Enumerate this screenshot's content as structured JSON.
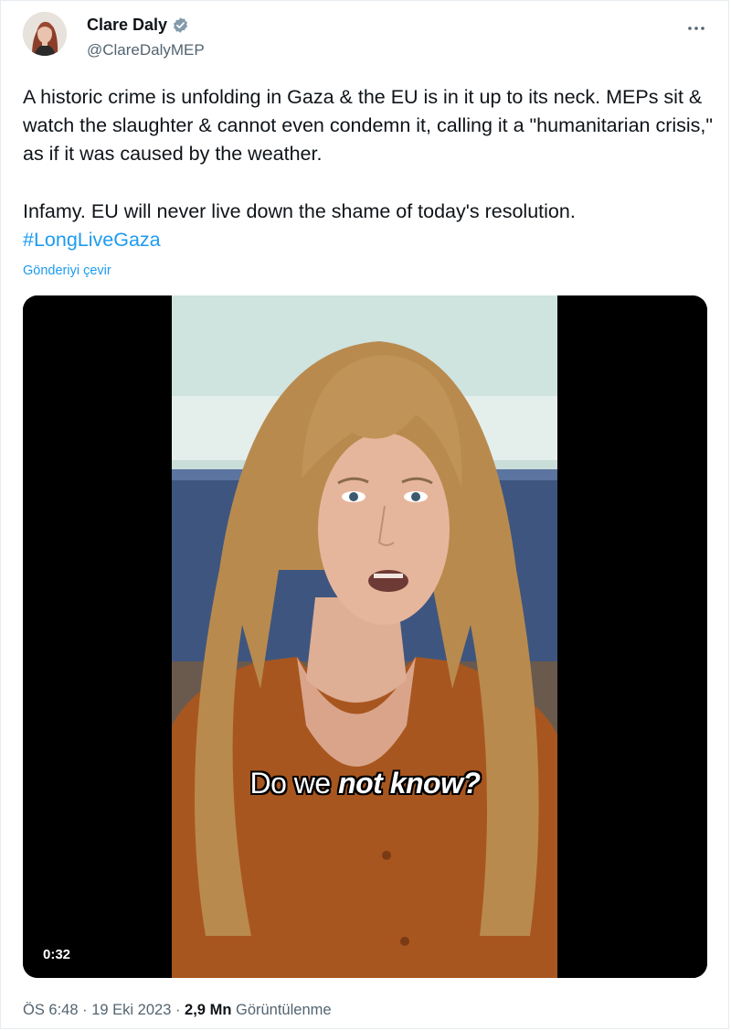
{
  "author": {
    "display_name": "Clare Daly",
    "handle": "@ClareDalyMEP",
    "verified_icon": "verified-badge-icon",
    "verified_color": "#829aab"
  },
  "more_icon": "ellipsis-icon",
  "tweet": {
    "paragraph1": "A historic crime is unfolding in Gaza & the EU is in it up to its neck. MEPs sit & watch the slaughter & cannot even condemn it, calling it a \"humanitarian crisis,\" as if it was caused by the weather.",
    "paragraph2": "Infamy. EU will never live down the shame of today's resolution.",
    "hashtag": "#LongLiveGaza",
    "translate_link": "Gönderiyi çevir"
  },
  "media": {
    "duration": "0:32",
    "caption_plain": "Do we ",
    "caption_emphasis": "not know?"
  },
  "meta": {
    "time": "ÖS 6:48",
    "separator1": " · ",
    "date": "19 Eki 2023",
    "separator2": " · ",
    "views_count": "2,9 Mn",
    "views_label": " Görüntülenme"
  },
  "colors": {
    "link": "#1d9bf0",
    "secondary_text": "#536471",
    "primary_text": "#0f1419"
  }
}
